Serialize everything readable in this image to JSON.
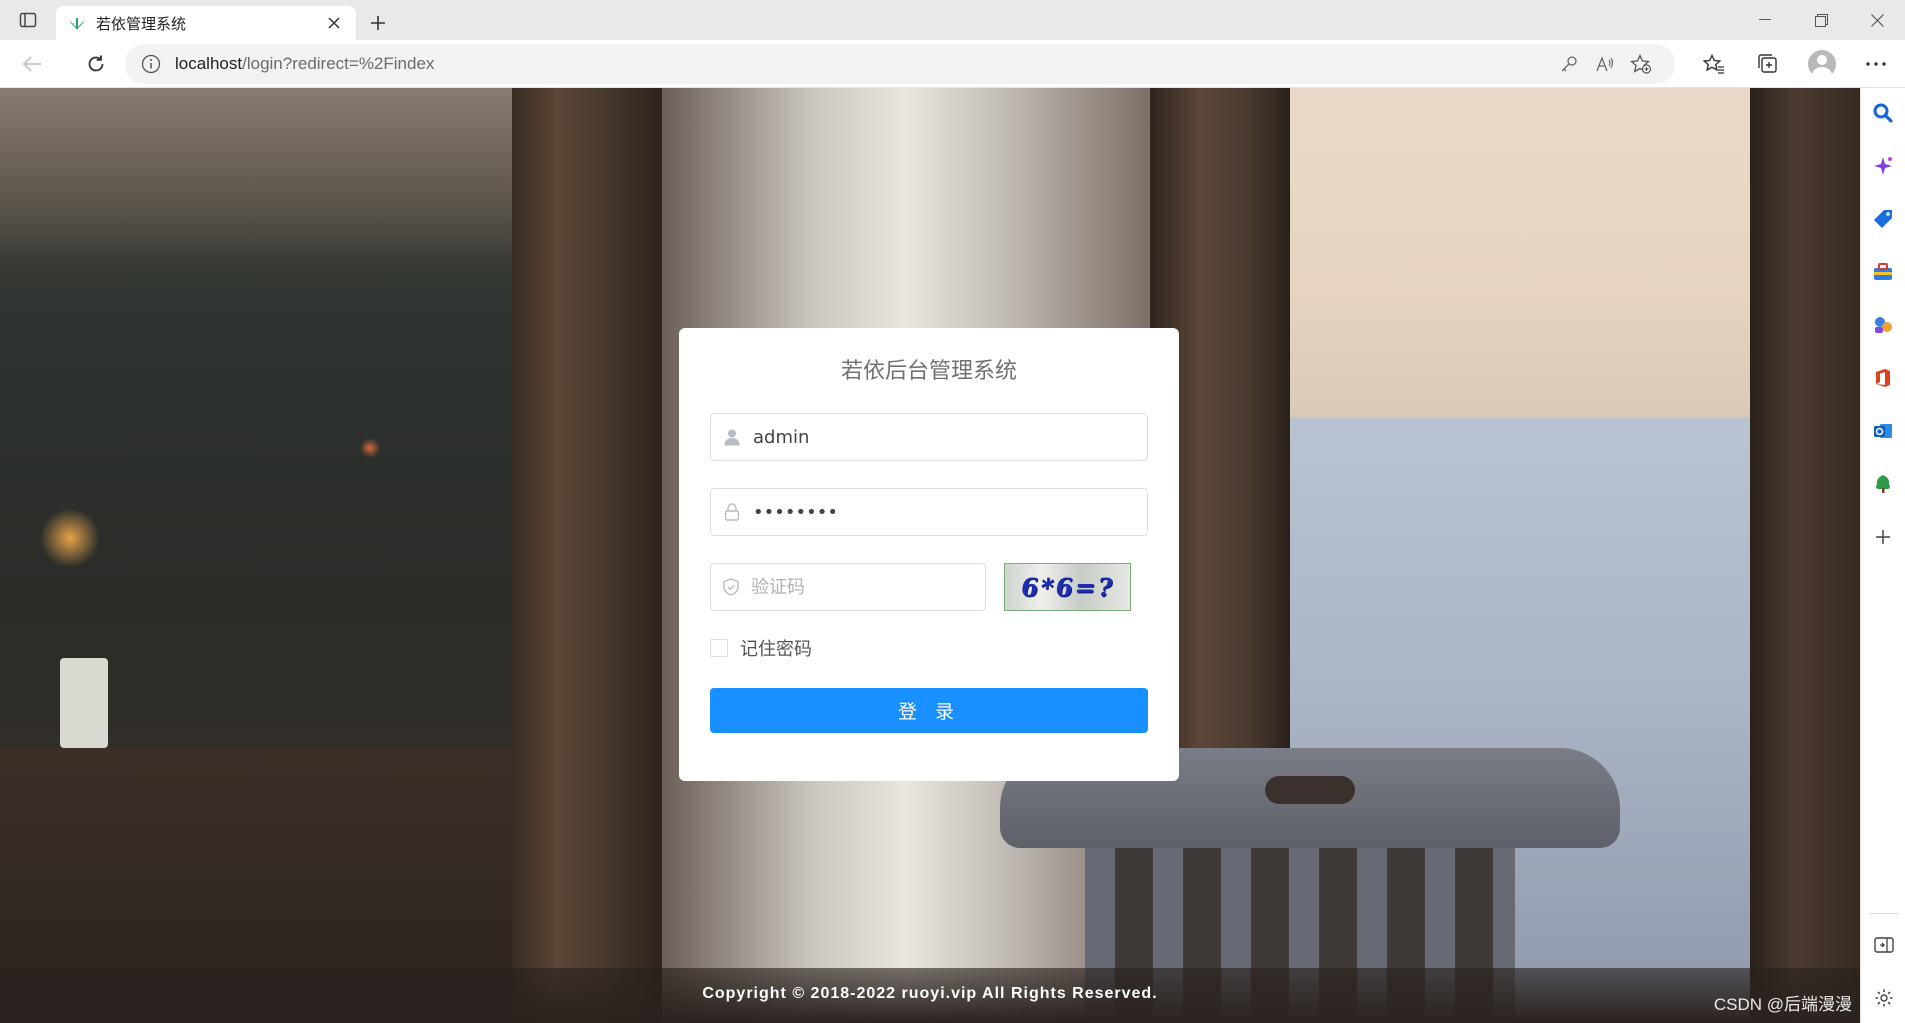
{
  "browser": {
    "tab_title": "若依管理系统",
    "url_host": "localhost",
    "url_path": "/login?redirect=%2Findex"
  },
  "login": {
    "title": "若依后台管理系统",
    "username_value": "admin",
    "password_value": "admin123",
    "captcha_placeholder": "验证码",
    "captcha_text": "6*6=?",
    "remember_label": "记住密码",
    "submit_label": "登 录"
  },
  "footer": {
    "copyright": "Copyright © 2018-2022 ruoyi.vip All Rights Reserved.",
    "watermark": "CSDN @后端漫漫"
  },
  "colors": {
    "primary": "#1890ff",
    "card_bg": "#ffffff"
  },
  "icons": {
    "sidebar": [
      "search-icon",
      "copilot-icon",
      "shopping-tag-icon",
      "toolbox-icon",
      "games-icon",
      "office-icon",
      "outlook-icon",
      "tree-icon",
      "add-icon"
    ]
  }
}
